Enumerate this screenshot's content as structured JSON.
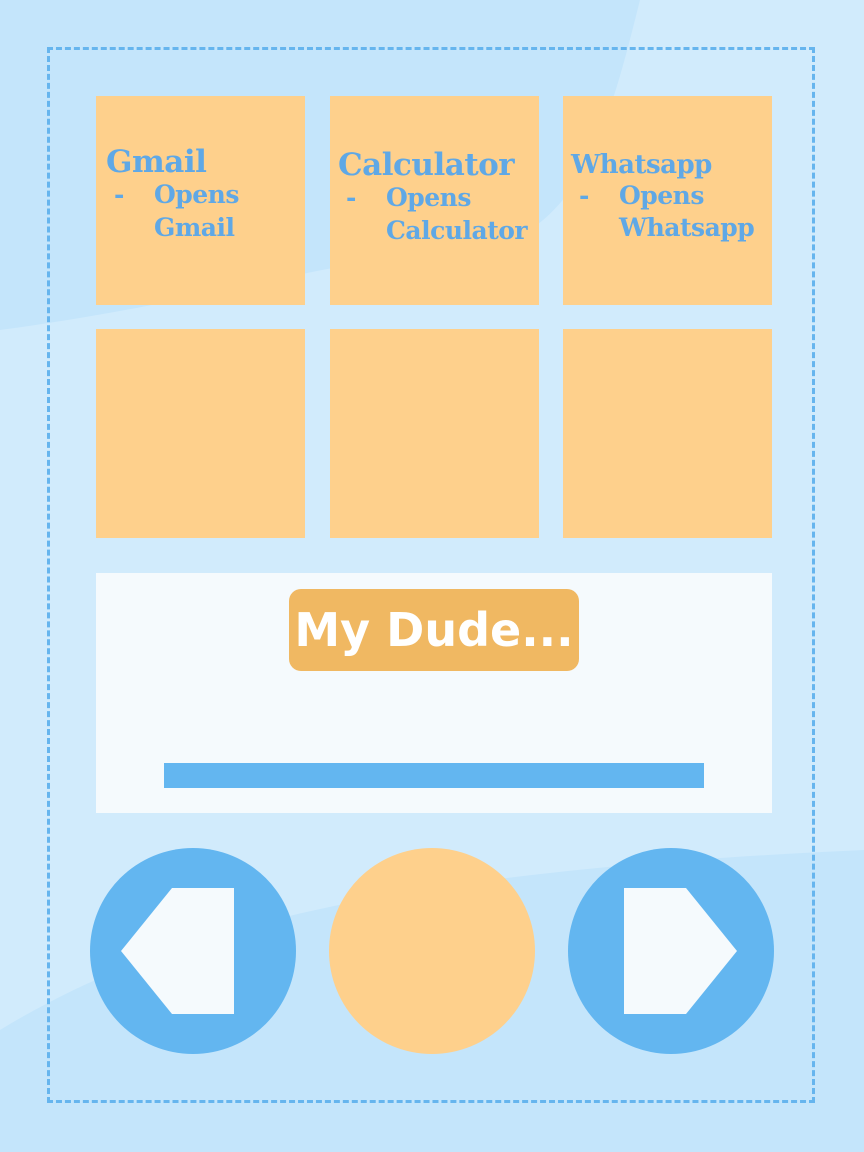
{
  "app_tiles": [
    {
      "title": "Gmail",
      "dash": "-",
      "line1": "Opens",
      "line2": "Gmail"
    },
    {
      "title": "Calculator",
      "dash": "-",
      "line1": "Opens",
      "line2": "Calculator"
    },
    {
      "title": "Whatsapp",
      "dash": "-",
      "line1": "Opens",
      "line2": "Whatsapp"
    }
  ],
  "empty_tiles_count": 3,
  "panel": {
    "title": "My Dude...",
    "progress": 1.0
  },
  "controls": {
    "prev_icon": "left-arrow-icon",
    "center_icon": "circle-button",
    "next_icon": "right-arrow-icon"
  },
  "colors": {
    "background": "#c4e5fb",
    "frame_border": "#66b5ee",
    "tile": "#fed08c",
    "tile_text": "#5fa8e6",
    "panel": "#f5fafd",
    "badge": "#f0b862",
    "progress": "#63b6f0",
    "control_blue": "#63b6f0",
    "control_orange": "#fed08c"
  }
}
